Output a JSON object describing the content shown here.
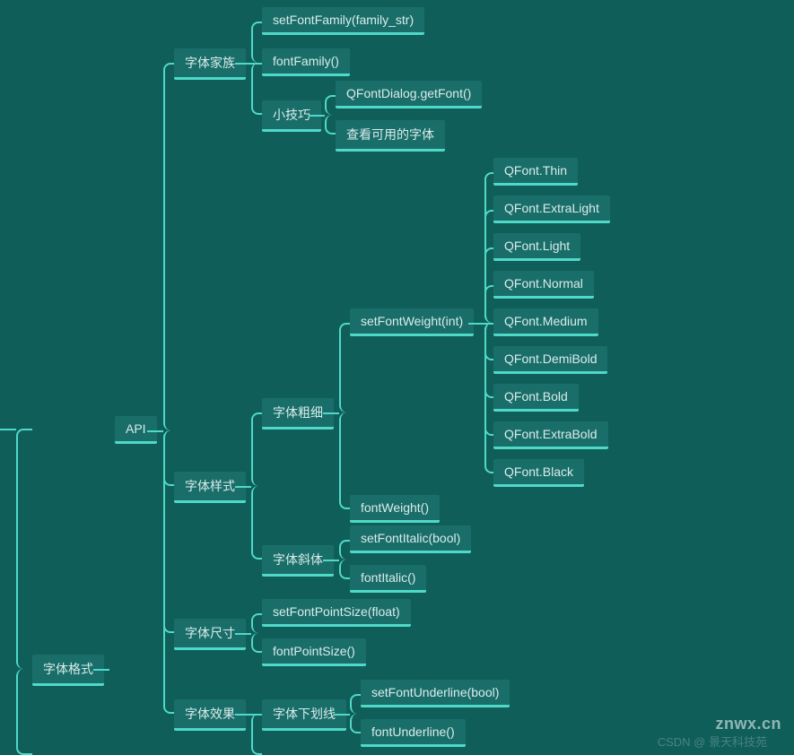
{
  "root": {
    "label": "字体格式"
  },
  "api": {
    "label": "API"
  },
  "family": {
    "label": "字体家族",
    "setFontFamily": "setFontFamily(family_str)",
    "fontFamily": "fontFamily()",
    "tips": {
      "label": "小技巧",
      "getFont": "QFontDialog.getFont()",
      "viewFonts": "查看可用的字体"
    }
  },
  "style": {
    "label": "字体样式",
    "weight": {
      "label": "字体粗细",
      "setFontWeight": "setFontWeight(int)",
      "fontWeight": "fontWeight()",
      "enums": {
        "thin": "QFont.Thin",
        "extraLight": "QFont.ExtraLight",
        "light": "QFont.Light",
        "normal": "QFont.Normal",
        "medium": "QFont.Medium",
        "demiBold": "QFont.DemiBold",
        "bold": "QFont.Bold",
        "extraBold": "QFont.ExtraBold",
        "black": "QFont.Black"
      }
    },
    "italic": {
      "label": "字体斜体",
      "setFontItalic": "setFontItalic(bool)",
      "fontItalic": "fontItalic()"
    }
  },
  "size": {
    "label": "字体尺寸",
    "setFontPointSize": "setFontPointSize(float)",
    "fontPointSize": "fontPointSize()"
  },
  "effect": {
    "label": "字体效果",
    "underline": {
      "label": "字体下划线",
      "setFontUnderline": "setFontUnderline(bool)",
      "fontUnderline": "fontUnderline()"
    }
  },
  "watermark": {
    "site": "znwx.cn",
    "credit": "CSDN @ 景天科技苑"
  }
}
